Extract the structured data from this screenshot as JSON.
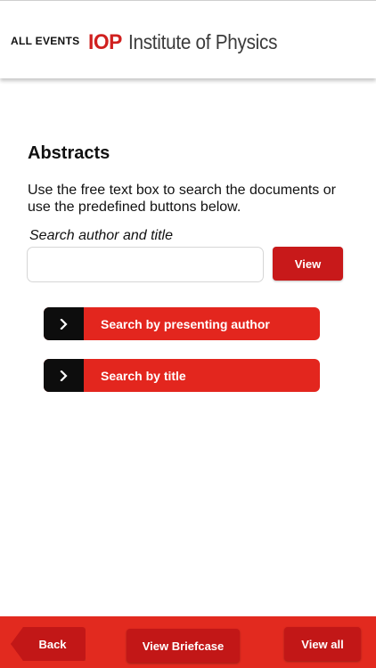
{
  "header": {
    "all_events": "ALL EVENTS",
    "logo_mark": "IOP",
    "logo_text": "Institute of Physics"
  },
  "main": {
    "title": "Abstracts",
    "intro": "Use the free text box to search the documents or use the predefined buttons below.",
    "search_label": "Search author and title",
    "search_value": "",
    "view_label": "View",
    "buttons": [
      {
        "label": "Search by presenting author",
        "icon": "chevron-right-icon"
      },
      {
        "label": "Search by title",
        "icon": "chevron-right-icon"
      }
    ]
  },
  "footer": {
    "back_label": "Back",
    "briefcase_label": "View Briefcase",
    "view_all_label": "View all"
  },
  "colors": {
    "brand_red": "#e3261e",
    "dark_red": "#c8191a",
    "icon_black": "#0d0d0d",
    "logo_gray": "#3b3b3b"
  }
}
